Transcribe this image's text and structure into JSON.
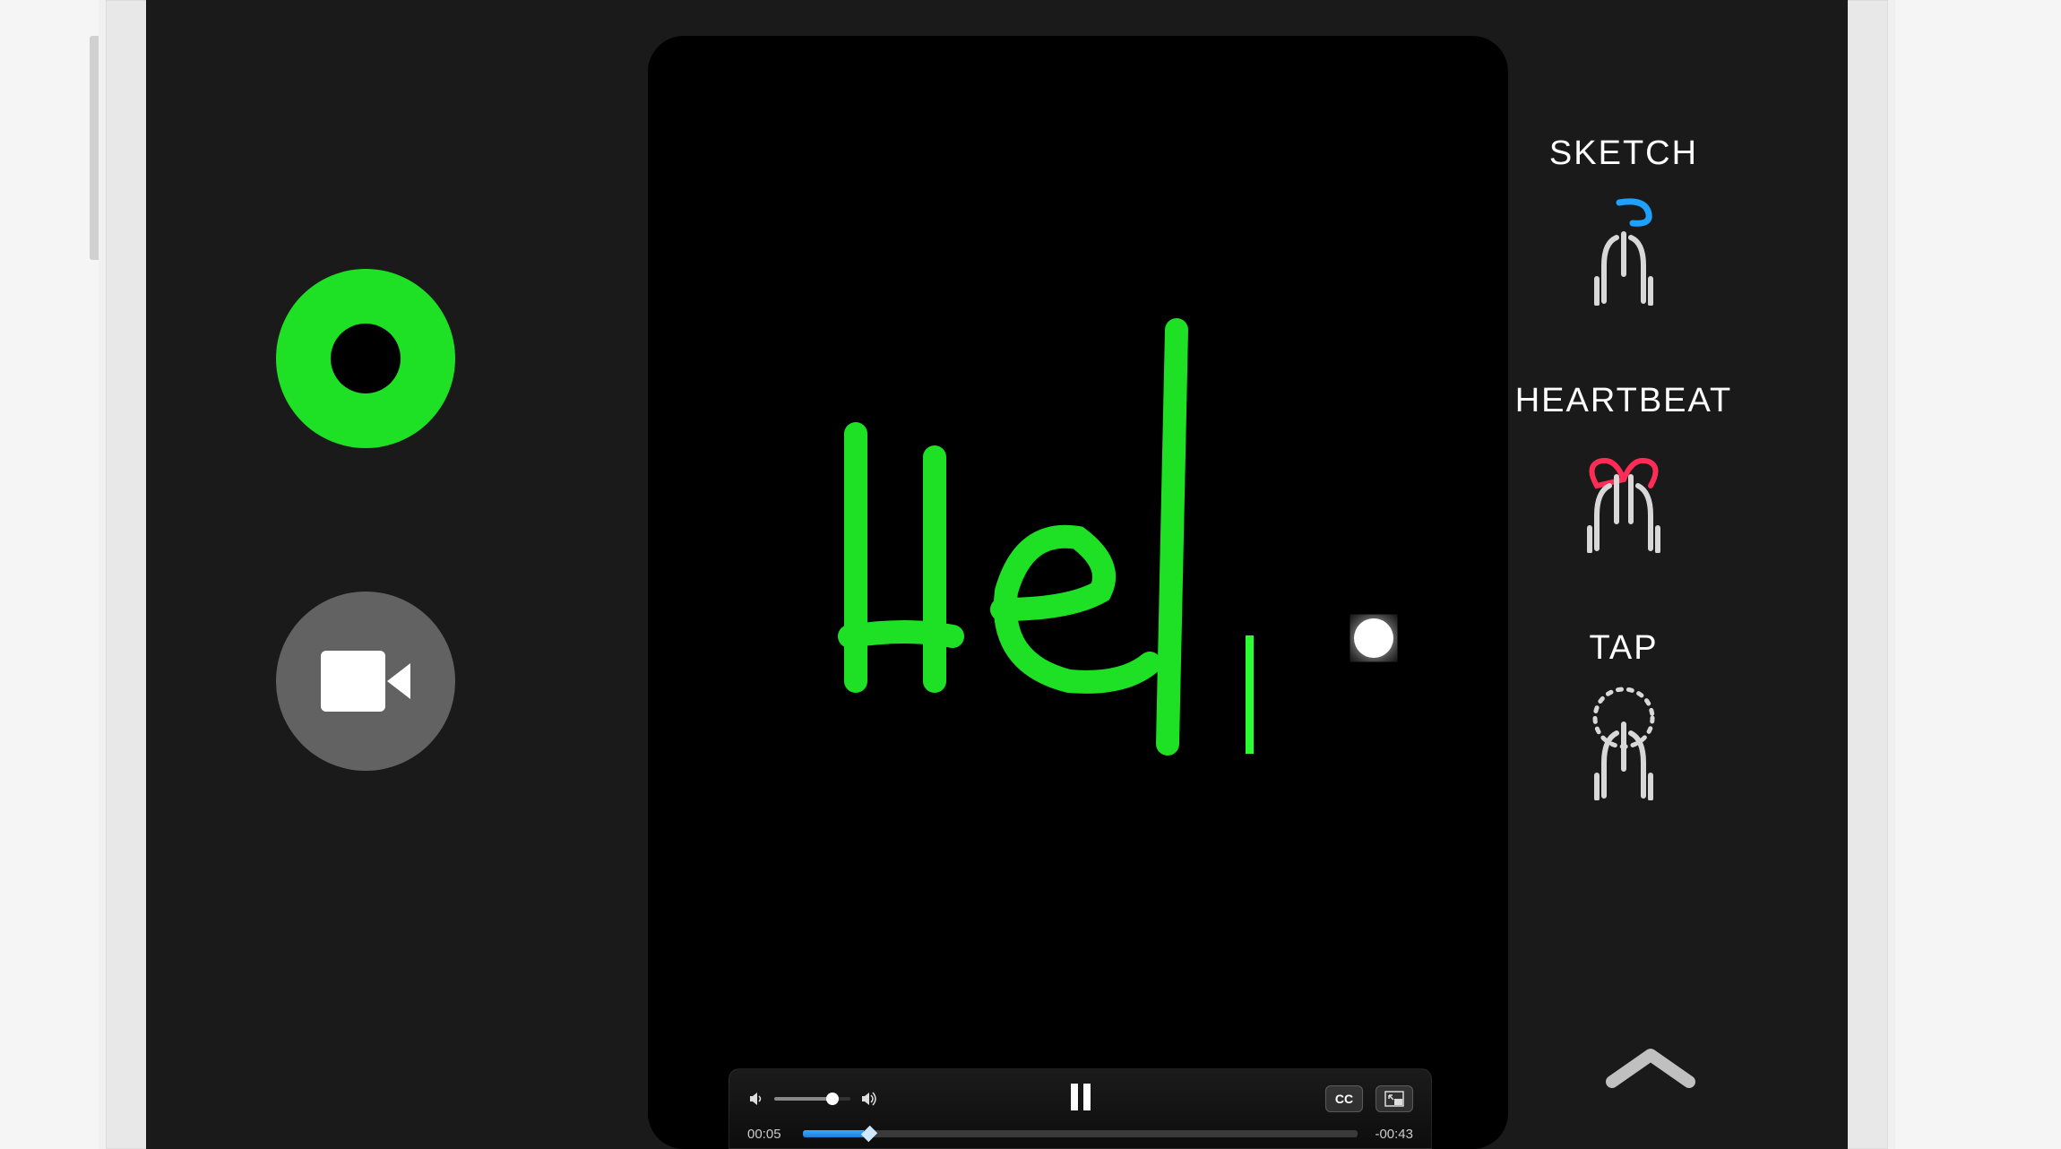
{
  "device": {
    "side_button": true
  },
  "colors": {
    "active_brush": "#1ee024",
    "ui_gray": "#626262",
    "heartbeat": "#ff2d55",
    "sketch_stroke": "#1fa2ff"
  },
  "left_tools": {
    "color_picker": "Color Picker",
    "camera": "Camera"
  },
  "canvas": {
    "drawn_text": "Hel",
    "has_glow_dot": true
  },
  "gestures": [
    {
      "key": "sketch",
      "label": "SKETCH"
    },
    {
      "key": "heartbeat",
      "label": "HEARTBEAT"
    },
    {
      "key": "tap",
      "label": "TAP"
    }
  ],
  "expand_hint": "Show More",
  "video_controls": {
    "elapsed": "00:05",
    "remaining": "-00:43",
    "volume_pct": 70,
    "progress_pct": 11,
    "playing": true,
    "cc_label": "CC",
    "pip_label": "PiP"
  }
}
